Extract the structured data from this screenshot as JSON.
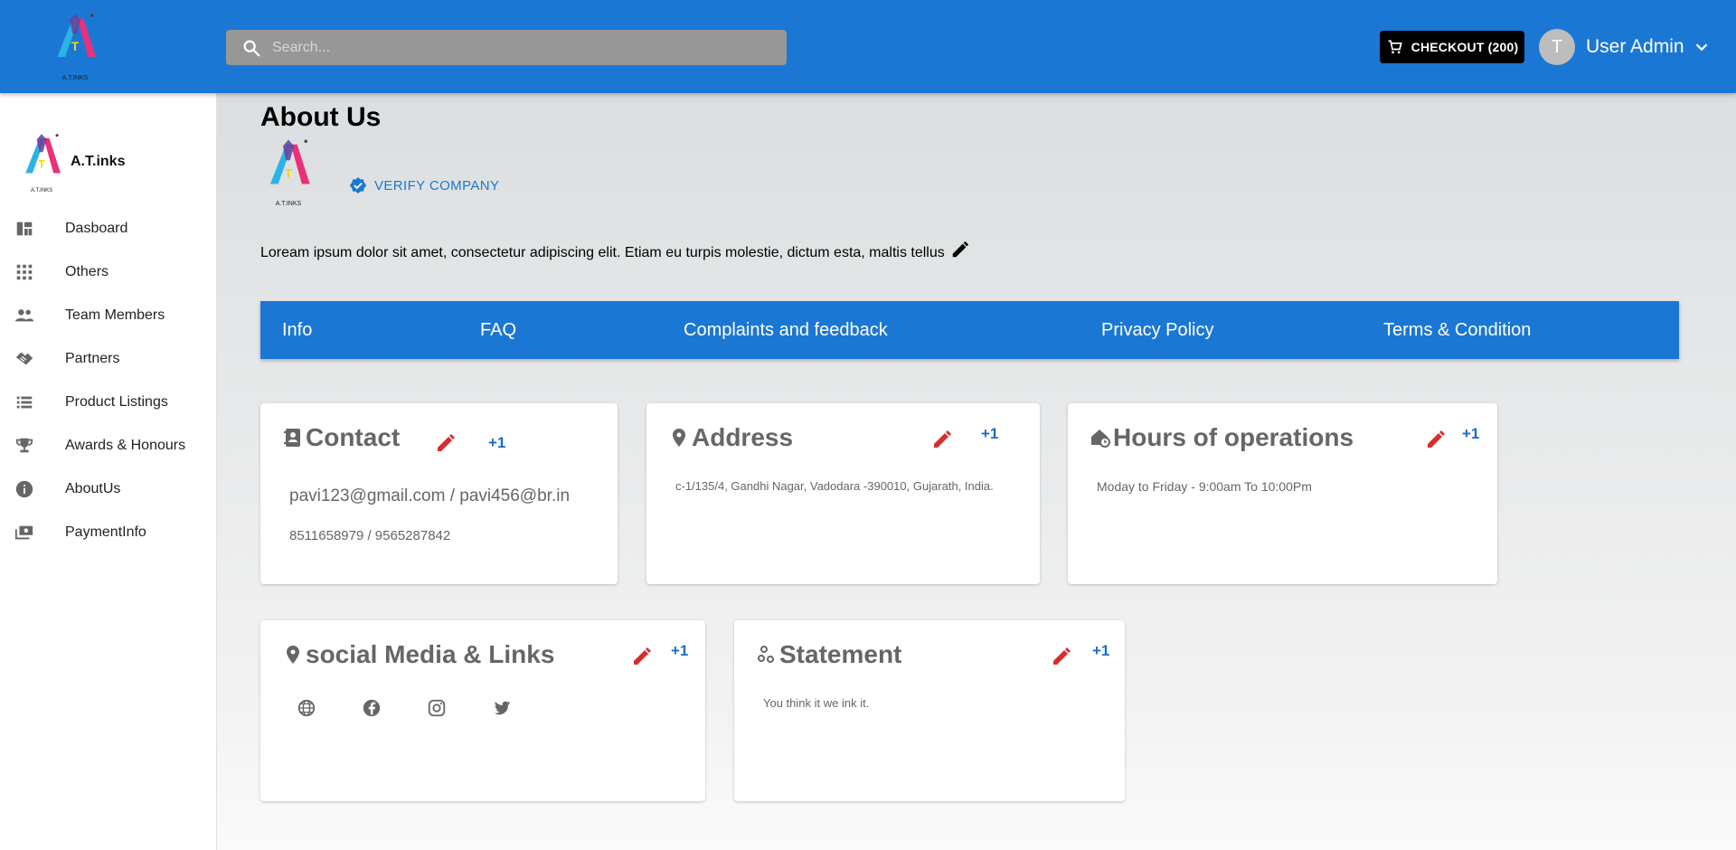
{
  "header": {
    "search_placeholder": "Search...",
    "checkout_label": "CHECKOUT (200)",
    "user_initial": "T",
    "user_name": "User Admin",
    "logo_text": "A.T.INKS",
    "colors": {
      "bar": "#1b77d4",
      "search": "#979797",
      "checkout": "#000000"
    }
  },
  "sidebar": {
    "brand_name": "A.T.inks",
    "logo_text": "A.T.INKS",
    "items": [
      {
        "label": "Dasboard",
        "icon": "dashboard-icon"
      },
      {
        "label": "Others",
        "icon": "apps-grid-icon"
      },
      {
        "label": "Team Members",
        "icon": "people-icon"
      },
      {
        "label": "Partners",
        "icon": "handshake-icon"
      },
      {
        "label": "Product Listings",
        "icon": "list-icon"
      },
      {
        "label": "Awards & Honours",
        "icon": "trophy-icon"
      },
      {
        "label": "AboutUs",
        "icon": "info-icon"
      },
      {
        "label": "PaymentInfo",
        "icon": "payment-icon"
      }
    ]
  },
  "main": {
    "title": "About Us",
    "logo_text": "A.T.INKS",
    "verify_label": "VERIFY COMPANY",
    "description": "Loream ipsum dolor sit amet, consectetur adipiscing elit. Etiam eu turpis molestie, dictum esta, maltis tellus",
    "tabs": [
      "Info",
      "FAQ",
      "Complaints and feedback",
      "Privacy Policy",
      "Terms & Condition"
    ],
    "cards": {
      "contact": {
        "title": "Contact",
        "plus": "+1",
        "email": "pavi123@gmail.com / pavi456@br.in",
        "phone": "8511658979 / 9565287842"
      },
      "address": {
        "title": "Address",
        "plus": "+1",
        "text": "c-1/135/4, Gandhi Nagar, Vadodara -390010, Gujarath, India."
      },
      "hours": {
        "title": "Hours of operations",
        "plus": "+1",
        "text": "Moday to Friday - 9:00am To 10:00Pm"
      },
      "social": {
        "title": "social Media & Links",
        "plus": "+1",
        "links": [
          "website-icon",
          "facebook-icon",
          "instagram-icon",
          "twitter-icon"
        ]
      },
      "statement": {
        "title": "Statement",
        "plus": "+1",
        "text": "You think it we ink it."
      }
    },
    "colors": {
      "edit": "#d32f2f",
      "plus": "#1b6cc6",
      "tabs": "#1b77d4"
    }
  }
}
